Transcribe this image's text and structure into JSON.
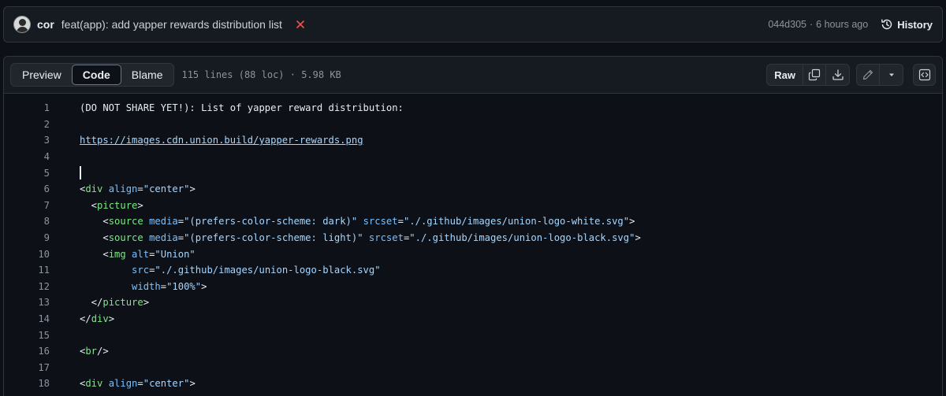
{
  "commit": {
    "author": "cor",
    "message": "feat(app): add yapper rewards distribution list",
    "sha": "044d305",
    "separator": "·",
    "time": "6 hours ago",
    "history_label": "History",
    "status_color": "#f85149"
  },
  "file_header": {
    "tabs": [
      "Preview",
      "Code",
      "Blame"
    ],
    "active_tab": "Code",
    "meta": "115 lines (88 loc) · 5.98 KB",
    "raw_label": "Raw",
    "icons": [
      "copy-icon",
      "download-icon",
      "pencil-icon",
      "triangle-down-icon",
      "code-square-icon"
    ]
  },
  "code_lines": [
    {
      "num": "1",
      "text": "(DO NOT SHARE YET!): List of yapper reward distribution:"
    },
    {
      "num": "2",
      "text": ""
    },
    {
      "num": "3",
      "text": "https://images.cdn.union.build/yapper-rewards.png"
    },
    {
      "num": "4",
      "text": ""
    },
    {
      "num": "5",
      "text": ""
    },
    {
      "num": "6",
      "text": "<div align=\"center\">"
    },
    {
      "num": "7",
      "text": "  <picture>"
    },
    {
      "num": "8",
      "text": "    <source media=\"(prefers-color-scheme: dark)\" srcset=\"./.github/images/union-logo-white.svg\">"
    },
    {
      "num": "9",
      "text": "    <source media=\"(prefers-color-scheme: light)\" srcset=\"./.github/images/union-logo-black.svg\">"
    },
    {
      "num": "10",
      "text": "    <img alt=\"Union\""
    },
    {
      "num": "11",
      "text": "         src=\"./.github/images/union-logo-black.svg\""
    },
    {
      "num": "12",
      "text": "         width=\"100%\">"
    },
    {
      "num": "13",
      "text": "  </picture>"
    },
    {
      "num": "14",
      "text": "</div>"
    },
    {
      "num": "15",
      "text": ""
    },
    {
      "num": "16",
      "text": "<br/>"
    },
    {
      "num": "17",
      "text": ""
    },
    {
      "num": "18",
      "text": "<div align=\"center\">"
    }
  ],
  "theme": {
    "background": "#0d1117",
    "tag_color": "#7ee787",
    "attr_color": "#79c0ff",
    "string_color": "#a5d6ff",
    "link_color": "#a5d6ff"
  }
}
